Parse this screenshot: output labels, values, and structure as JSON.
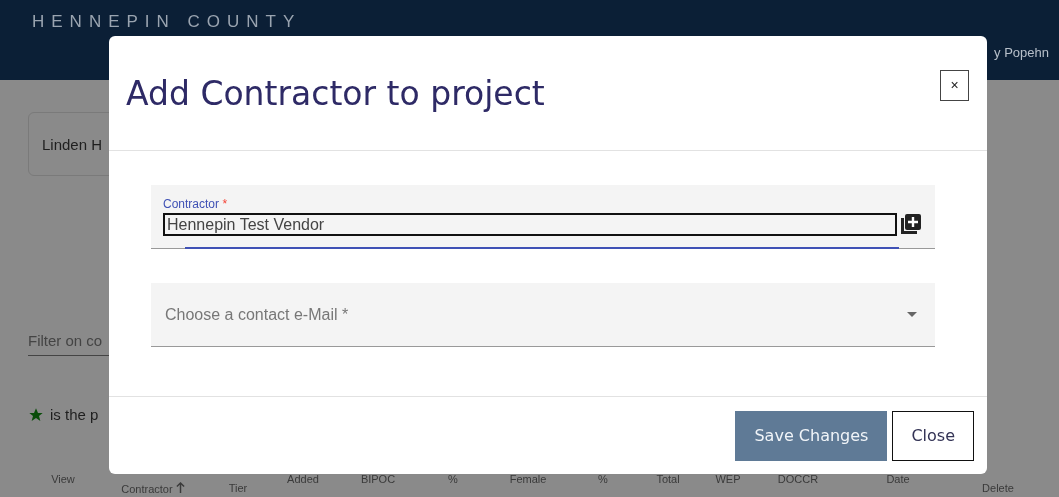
{
  "header": {
    "brand": "HENNEPIN COUNTY",
    "user": "y Popehn"
  },
  "page": {
    "project_card": "Linden H",
    "filter": {
      "placeholder": "Filter on co"
    },
    "legend": "is the p",
    "table": {
      "columns": [
        {
          "label": "View",
          "sorted": false
        },
        {
          "label": "Contractor",
          "sorted": true
        },
        {
          "label": "Tier",
          "sorted": false
        },
        {
          "label": "Added",
          "sorted": false
        },
        {
          "label": "BIPOC",
          "sorted": false
        },
        {
          "label": "%",
          "sorted": false
        },
        {
          "label": "Female",
          "sorted": false
        },
        {
          "label": "%",
          "sorted": false
        },
        {
          "label": "Total",
          "sorted": false
        },
        {
          "label": "WEP",
          "sorted": false
        },
        {
          "label": "DOCCR",
          "sorted": false
        },
        {
          "label": "Date",
          "sorted": false
        },
        {
          "label": "Delete",
          "sorted": false
        }
      ]
    }
  },
  "dialog": {
    "title": "Add Contractor to project",
    "close_symbol": "×",
    "contractor": {
      "label": "Contractor",
      "required_mark": "*",
      "value": "Hennepin Test Vendor"
    },
    "contact": {
      "placeholder": "Choose a contact e-Mail *"
    },
    "buttons": [
      {
        "label": "Save Changes",
        "kind": "primary"
      },
      {
        "label": "Close",
        "kind": "secondary"
      }
    ]
  }
}
